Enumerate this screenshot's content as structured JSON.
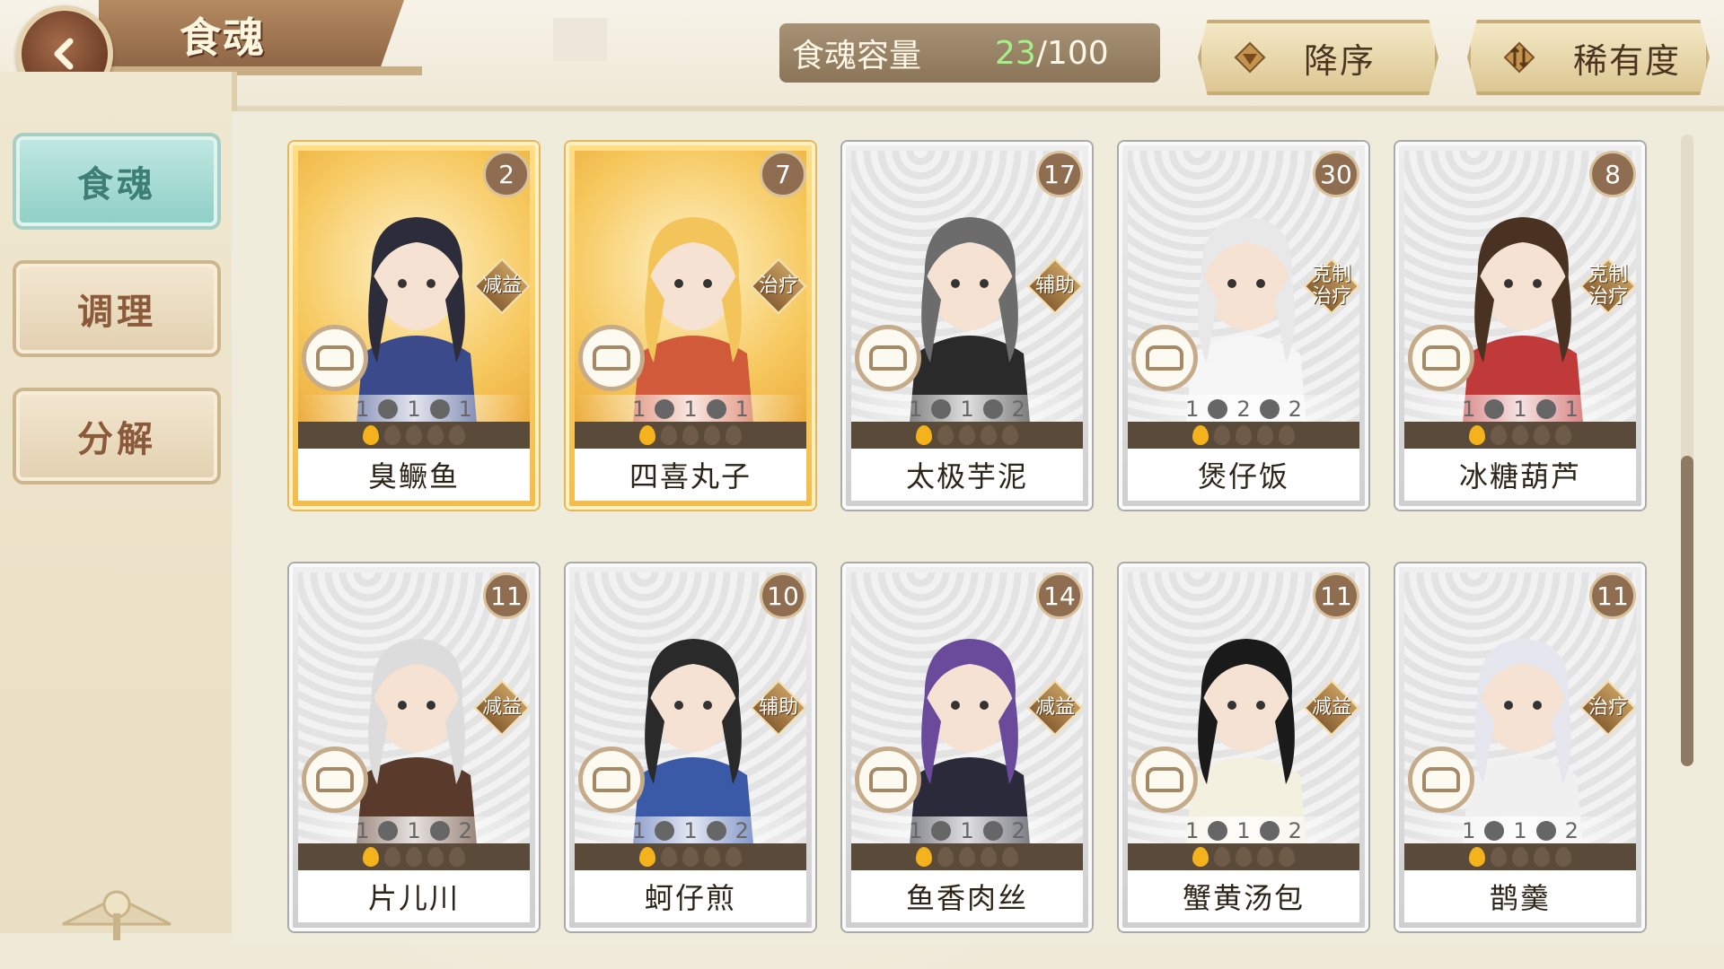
{
  "header": {
    "title": "食魂",
    "capacity_label": "食魂容量",
    "capacity_current": "23",
    "capacity_max": "/100",
    "sort_order_label": "降序",
    "sort_by_label": "稀有度"
  },
  "sidebar": {
    "items": [
      {
        "label": "食魂",
        "active": true
      },
      {
        "label": "调理",
        "active": false
      },
      {
        "label": "分解",
        "active": false
      }
    ]
  },
  "colors": {
    "accent_teal": "#8fd0c7",
    "gold_card": "#f3bd4c",
    "silver_card": "#cfcfcf",
    "capacity_current_green": "#a6f08a",
    "flame_on": "#f4b21c"
  },
  "cards": [
    {
      "name": "臭鳜鱼",
      "count": "2",
      "role": "减益",
      "rarity": "gold",
      "stats": [
        "1",
        "1",
        "1"
      ],
      "flames": 1,
      "hair": "#2c2c3a",
      "robe": "#3a4a8a"
    },
    {
      "name": "四喜丸子",
      "count": "7",
      "role": "治疗",
      "rarity": "gold",
      "stats": [
        "1",
        "1",
        "1"
      ],
      "flames": 1,
      "hair": "#f2c45a",
      "robe": "#d05a3a"
    },
    {
      "name": "太极芋泥",
      "count": "17",
      "role": "辅助",
      "rarity": "silver",
      "stats": [
        "1",
        "1",
        "2"
      ],
      "flames": 1,
      "hair": "#6c6c6c",
      "robe": "#2a2a2a"
    },
    {
      "name": "煲仔饭",
      "count": "30",
      "role": "克制\n治疗",
      "rarity": "silver",
      "stats": [
        "1",
        "2",
        "2"
      ],
      "flames": 1,
      "hair": "#e8e8e8",
      "robe": "#f6f6f6"
    },
    {
      "name": "冰糖葫芦",
      "count": "8",
      "role": "克制\n治疗",
      "rarity": "silver",
      "stats": [
        "1",
        "1",
        "1"
      ],
      "flames": 1,
      "hair": "#4a3222",
      "robe": "#c03a3a"
    },
    {
      "name": "片儿川",
      "count": "11",
      "role": "减益",
      "rarity": "silver",
      "stats": [
        "1",
        "1",
        "2"
      ],
      "flames": 1,
      "hair": "#dcdcdc",
      "robe": "#5a3a2a"
    },
    {
      "name": "蚵仔煎",
      "count": "10",
      "role": "辅助",
      "rarity": "silver",
      "stats": [
        "1",
        "1",
        "2"
      ],
      "flames": 1,
      "hair": "#2a2a2a",
      "robe": "#3a5aa8"
    },
    {
      "name": "鱼香肉丝",
      "count": "14",
      "role": "减益",
      "rarity": "silver",
      "stats": [
        "1",
        "1",
        "2"
      ],
      "flames": 1,
      "hair": "#6a4a9a",
      "robe": "#2a2a3a"
    },
    {
      "name": "蟹黄汤包",
      "count": "11",
      "role": "减益",
      "rarity": "silver",
      "stats": [
        "1",
        "1",
        "2"
      ],
      "flames": 1,
      "hair": "#1a1a1a",
      "robe": "#f4f0e0"
    },
    {
      "name": "鹊羹",
      "count": "11",
      "role": "治疗",
      "rarity": "silver",
      "stats": [
        "1",
        "1",
        "2"
      ],
      "flames": 1,
      "hair": "#e6e6ee",
      "robe": "#f0f0f0"
    }
  ]
}
